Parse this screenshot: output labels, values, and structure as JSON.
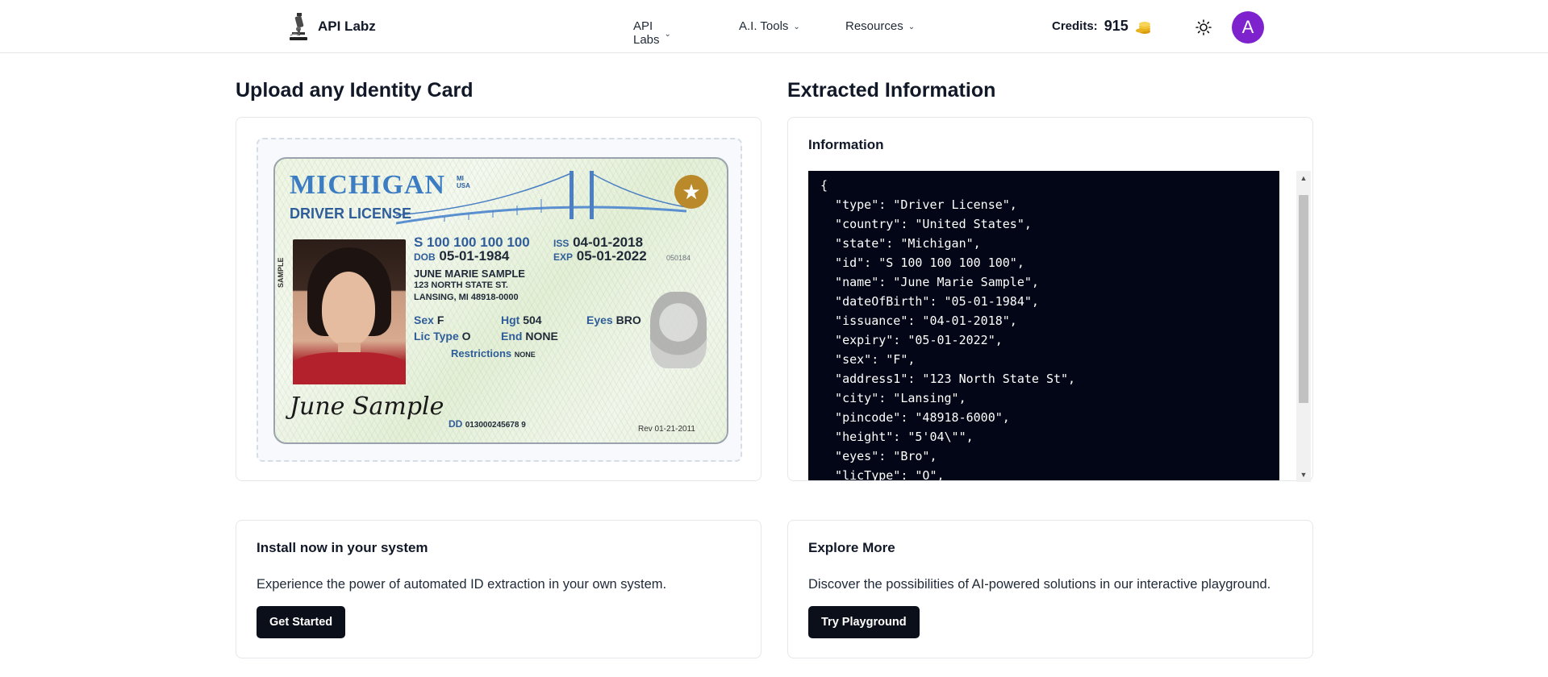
{
  "header": {
    "brand_name": "API Labz",
    "nav": [
      {
        "label": "API Labs"
      },
      {
        "label": "A.I. Tools"
      },
      {
        "label": "Resources"
      }
    ],
    "credits_label": "Credits:",
    "credits_value": "915",
    "avatar_initial": "A"
  },
  "upload": {
    "title": "Upload any Identity Card",
    "id_card": {
      "state": "MICHIGAN",
      "state_sub_1": "MI",
      "state_sub_2": "USA",
      "type": "DRIVER LICENSE",
      "license_no": "S 100 100 100 100",
      "dob_label": "DOB",
      "dob": "05-01-1984",
      "iss_label": "ISS",
      "iss": "04-01-2018",
      "exp_label": "EXP",
      "exp": "05-01-2022",
      "doc_num": "050184",
      "name": "JUNE MARIE SAMPLE",
      "addr1": "123 NORTH STATE ST.",
      "addr2": "LANSING, MI 48918-0000",
      "sex_label": "Sex",
      "sex": "F",
      "hgt_label": "Hgt",
      "hgt": "504",
      "eyes_label": "Eyes",
      "eyes": "BRO",
      "lictype_label": "Lic Type",
      "lictype": "O",
      "end_label": "End",
      "end": "NONE",
      "restrictions_label": "Restrictions",
      "restrictions": "NONE",
      "dd_label": "DD",
      "dd": "013000245678 9",
      "rev": "Rev 01-21-2011",
      "sample_text": "SAMPLE",
      "signature": "June Sample"
    }
  },
  "extracted": {
    "title": "Extracted Information",
    "heading": "Information",
    "json_text": "{\n  \"type\": \"Driver License\",\n  \"country\": \"United States\",\n  \"state\": \"Michigan\",\n  \"id\": \"S 100 100 100 100\",\n  \"name\": \"June Marie Sample\",\n  \"dateOfBirth\": \"05-01-1984\",\n  \"issuance\": \"04-01-2018\",\n  \"expiry\": \"05-01-2022\",\n  \"sex\": \"F\",\n  \"address1\": \"123 North State St\",\n  \"city\": \"Lansing\",\n  \"pincode\": \"48918-6000\",\n  \"height\": \"5'04\\\"\",\n  \"eyes\": \"Bro\",\n  \"licType\": \"O\","
  },
  "install": {
    "title": "Install now in your system",
    "description": "Experience the power of automated ID extraction in your own system.",
    "button": "Get Started"
  },
  "explore": {
    "title": "Explore More",
    "description": "Discover the possibilities of AI-powered solutions in our interactive playground.",
    "button": "Try Playground"
  },
  "icons": {
    "brand": "microscope-icon",
    "theme": "sun-icon",
    "credits": "coins-icon",
    "nav_chevron": "chevron-down-icon"
  },
  "colors": {
    "avatar": "#7e22ce",
    "button": "#0b0f19",
    "code_bg": "#030616",
    "coin": "#e8b21f"
  }
}
